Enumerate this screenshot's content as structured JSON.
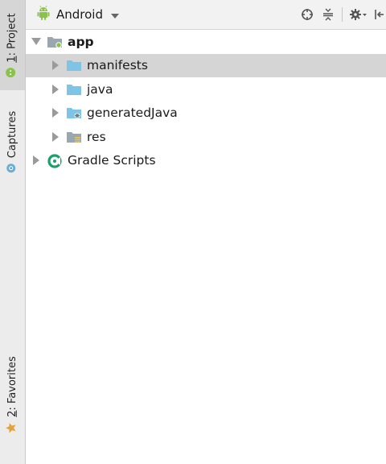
{
  "side_strip": {
    "project_tab": {
      "number": "1",
      "label": ": Project"
    },
    "captures_tab": {
      "label": "Captures"
    },
    "favorites_tab": {
      "number": "2",
      "label": ": Favorites"
    }
  },
  "toolbar": {
    "view_mode": "Android",
    "icons": [
      "locate-icon",
      "collapse-all-icon",
      "settings-icon",
      "hide-panel-icon"
    ]
  },
  "tree": {
    "root": {
      "label": "app",
      "expanded": true
    },
    "children": [
      {
        "label": "manifests",
        "selected": true
      },
      {
        "label": "java"
      },
      {
        "label": "generatedJava"
      },
      {
        "label": "res"
      }
    ],
    "gradle": {
      "label": "Gradle Scripts"
    }
  },
  "colors": {
    "folder_blue": "#7ec4e6",
    "folder_gray": "#9aa7b0",
    "android_green": "#8bc34a",
    "gradle_green": "#1aa068",
    "selection": "#d5d5d5",
    "star": "#e3a23b"
  }
}
